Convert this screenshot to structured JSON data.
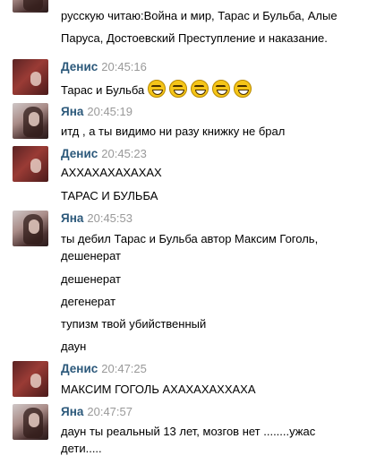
{
  "messages": [
    {
      "lines": [
        "русскую читаю:Война и мир, Тарас и Бульба, Алые",
        "Паруса, Достоевский Преступление и наказание."
      ]
    },
    {
      "sender": "Денис",
      "time": "20:45:16",
      "lines": [
        "Тарас и Бульба"
      ],
      "emoji": [
        "grin-emoji",
        "grin-emoji",
        "grin-emoji",
        "grin-emoji",
        "grin-emoji"
      ]
    },
    {
      "sender": "Яна",
      "time": "20:45:19",
      "lines": [
        "итд , а ты видимо ни разу книжку не брал"
      ]
    },
    {
      "sender": "Денис",
      "time": "20:45:23",
      "lines": [
        "АХХАХАХАХАХАХ",
        "ТАРАС И БУЛЬБА"
      ]
    },
    {
      "sender": "Яна",
      "time": "20:45:53",
      "lines": [
        "ты дебил Тарас и Бульба автор Максим Гоголь,",
        "дешенерат",
        "дешенерат",
        "дегенерат",
        "тупизм твой убийственный",
        "даун"
      ]
    },
    {
      "sender": "Денис",
      "time": "20:47:25",
      "lines": [
        "МАКСИМ ГОГОЛЬ АХАХАХАХХАХА"
      ]
    },
    {
      "sender": "Яна",
      "time": "20:47:57",
      "lines": [
        "даун ты реальный 13 лет, мозгов нет ........ужас",
        "дети....."
      ]
    }
  ]
}
